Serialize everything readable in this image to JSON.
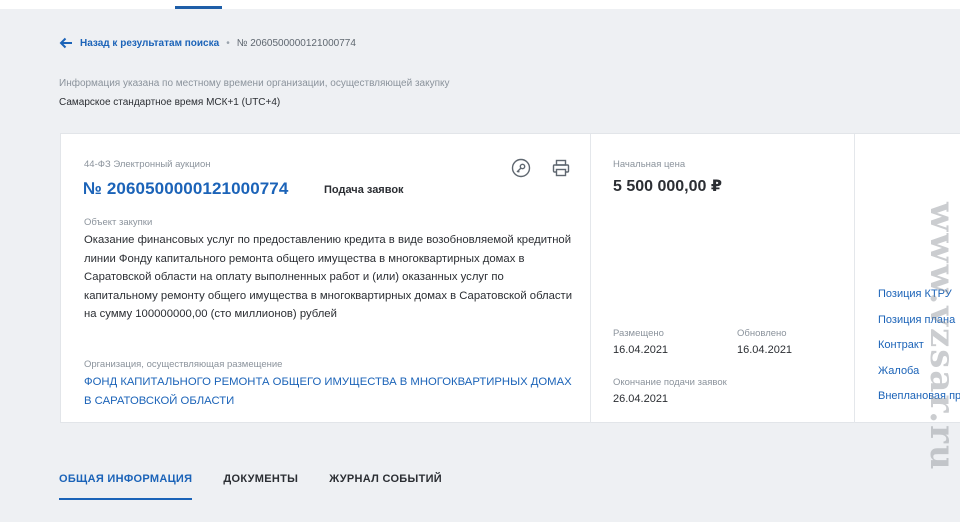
{
  "breadcrumb": {
    "back_label": "Назад к результатам поиска",
    "separator": "•",
    "current": "№ 2060500000121000774"
  },
  "timezone": {
    "note": "Информация указана по местному времени организации, осуществляющей закупку",
    "value": "Самарское стандартное время МСК+1 (UTC+4)"
  },
  "card": {
    "law_type": "44-ФЗ Электронный аукцион",
    "purchase_number": "№ 2060500000121000774",
    "status": "Подача заявок",
    "icons": [
      "key-icon",
      "print-icon"
    ],
    "object_label": "Объект закупки",
    "object_text": "Оказание финансовых услуг по предоставлению кредита в виде возобновляемой кредитной линии Фонду капитального ремонта общего имущества в многоквартирных домах в Саратовской области на оплату выполненных работ и (или) оказанных услуг по капитальному ремонту общего имущества в многоквартирных домах в Саратовской области  на сумму 100000000,00 (сто миллионов) рублей",
    "org_label": "Организация, осуществляющая размещение",
    "org_name": "ФОНД КАПИТАЛЬНОГО РЕМОНТА ОБЩЕГО ИМУЩЕСТВА В МНОГОКВАРТИРНЫХ ДОМАХ В САРАТОВСКОЙ ОБЛАСТИ",
    "price_label": "Начальная цена",
    "price": "5 500 000,00 ₽",
    "placed_label": "Размещено",
    "placed_date": "16.04.2021",
    "updated_label": "Обновлено",
    "updated_date": "16.04.2021",
    "end_label": "Окончание подачи заявок",
    "end_date": "26.04.2021"
  },
  "side_links": [
    "Позиция КТРУ",
    "Позиция плана",
    "Контракт",
    "Жалоба",
    "Внеплановая проверка"
  ],
  "tabs": [
    "ОБЩАЯ ИНФОРМАЦИЯ",
    "ДОКУМЕНТЫ",
    "ЖУРНАЛ СОБЫТИЙ"
  ],
  "watermark": "www.vzsar.ru",
  "colors": {
    "accent": "#1b63b8",
    "background": "#eef0f3",
    "card": "#ffffff"
  }
}
